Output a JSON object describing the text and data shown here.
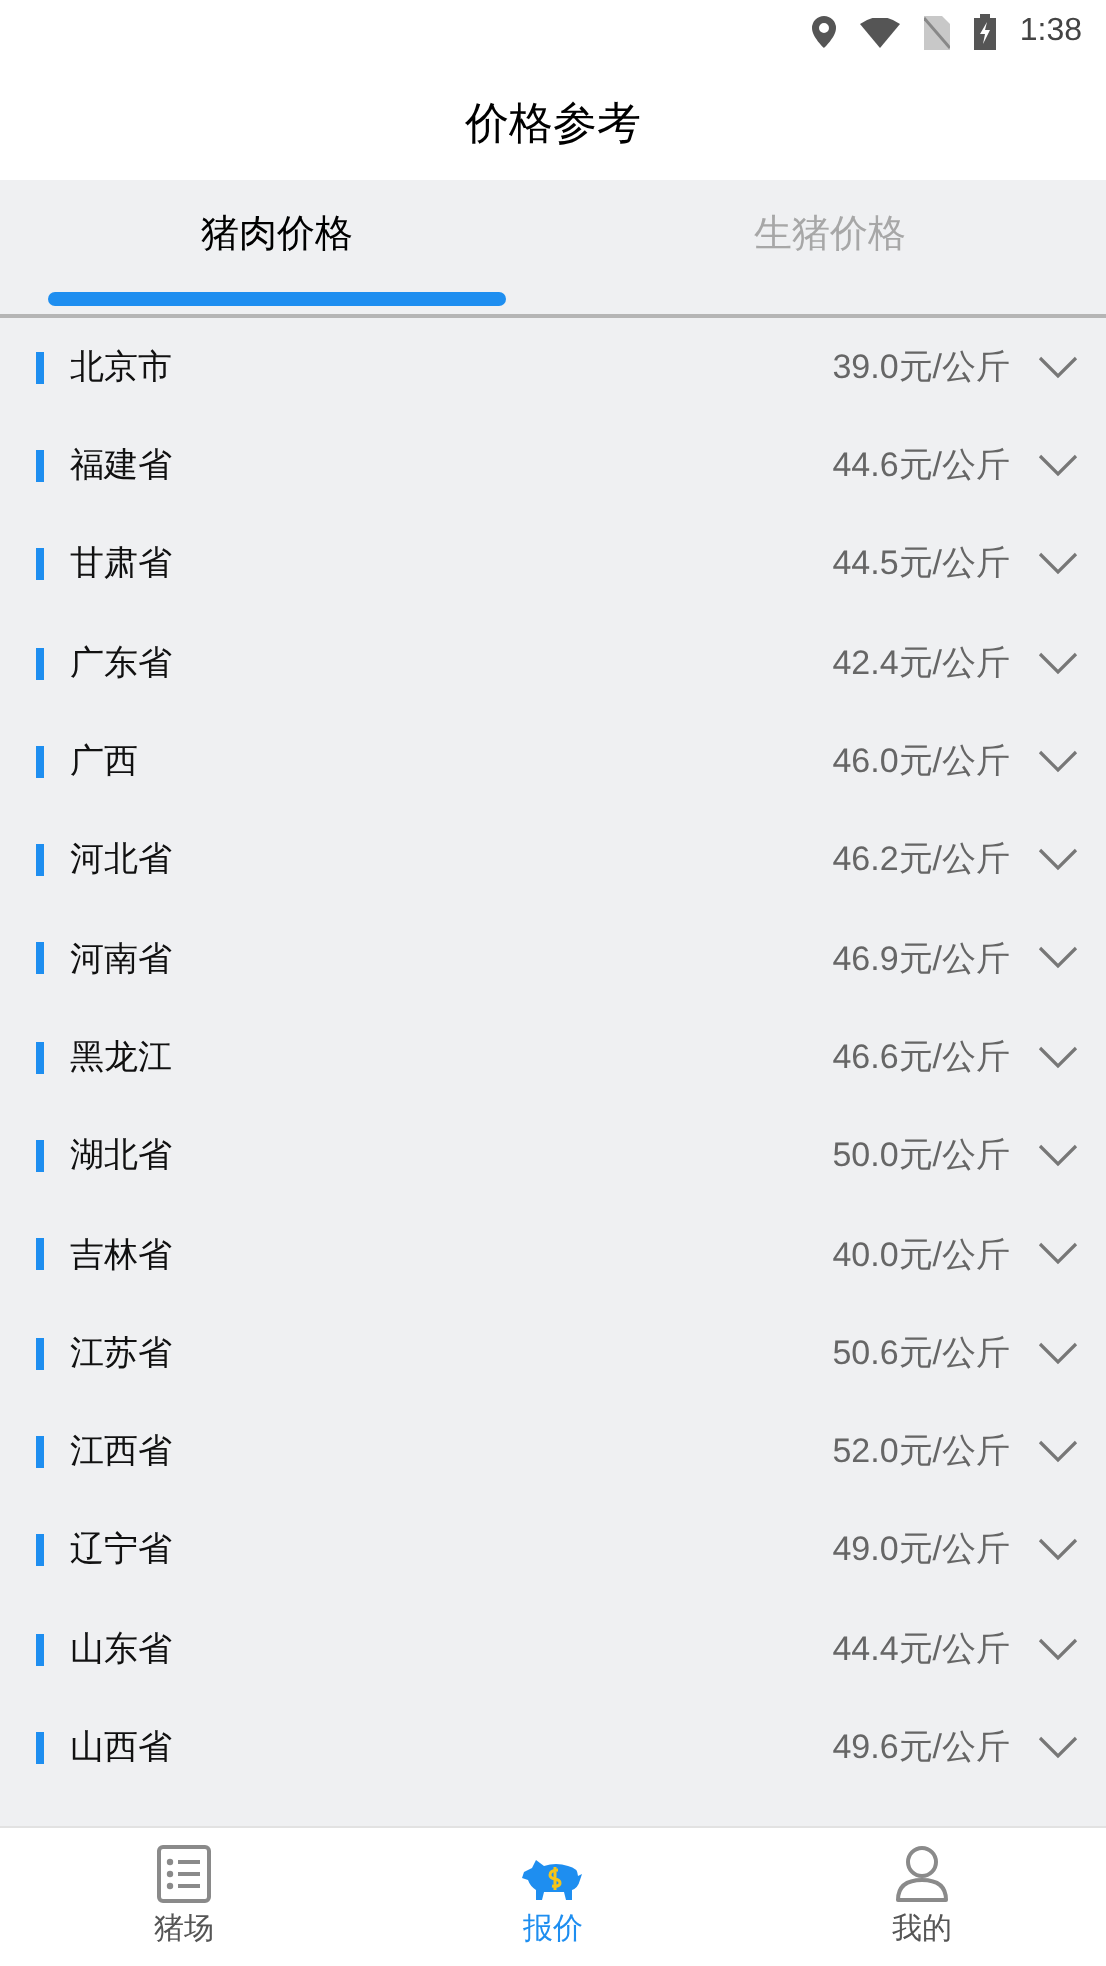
{
  "status_bar": {
    "time": "1:38"
  },
  "header": {
    "title": "价格参考"
  },
  "tabs": [
    {
      "label": "猪肉价格",
      "selected": true
    },
    {
      "label": "生猪价格",
      "selected": false
    }
  ],
  "rows": [
    {
      "region": "北京市",
      "price": "39.0元/公斤",
      "expanded": false
    },
    {
      "region": "福建省",
      "price": "44.6元/公斤",
      "expanded": false
    },
    {
      "region": "甘肃省",
      "price": "44.5元/公斤",
      "expanded": false
    },
    {
      "region": "广东省",
      "price": "42.4元/公斤",
      "expanded": false
    },
    {
      "region": "广西",
      "price": "46.0元/公斤",
      "expanded": false
    },
    {
      "region": "河北省",
      "price": "46.2元/公斤",
      "expanded": false
    },
    {
      "region": "河南省",
      "price": "46.9元/公斤",
      "expanded": false
    },
    {
      "region": "黑龙江",
      "price": "46.6元/公斤",
      "expanded": false
    },
    {
      "region": "湖北省",
      "price": "50.0元/公斤",
      "expanded": false
    },
    {
      "region": "吉林省",
      "price": "40.0元/公斤",
      "expanded": false
    },
    {
      "region": "江苏省",
      "price": "50.6元/公斤",
      "expanded": false
    },
    {
      "region": "江西省",
      "price": "52.0元/公斤",
      "expanded": false
    },
    {
      "region": "辽宁省",
      "price": "49.0元/公斤",
      "expanded": false
    },
    {
      "region": "山东省",
      "price": "44.4元/公斤",
      "expanded": false
    },
    {
      "region": "山西省",
      "price": "49.6元/公斤",
      "expanded": false
    }
  ],
  "bottom_nav": [
    {
      "label": "猪场",
      "kind": "list",
      "selected": false
    },
    {
      "label": "报价",
      "kind": "pig",
      "selected": true
    },
    {
      "label": "我的",
      "kind": "person",
      "selected": false
    }
  ]
}
